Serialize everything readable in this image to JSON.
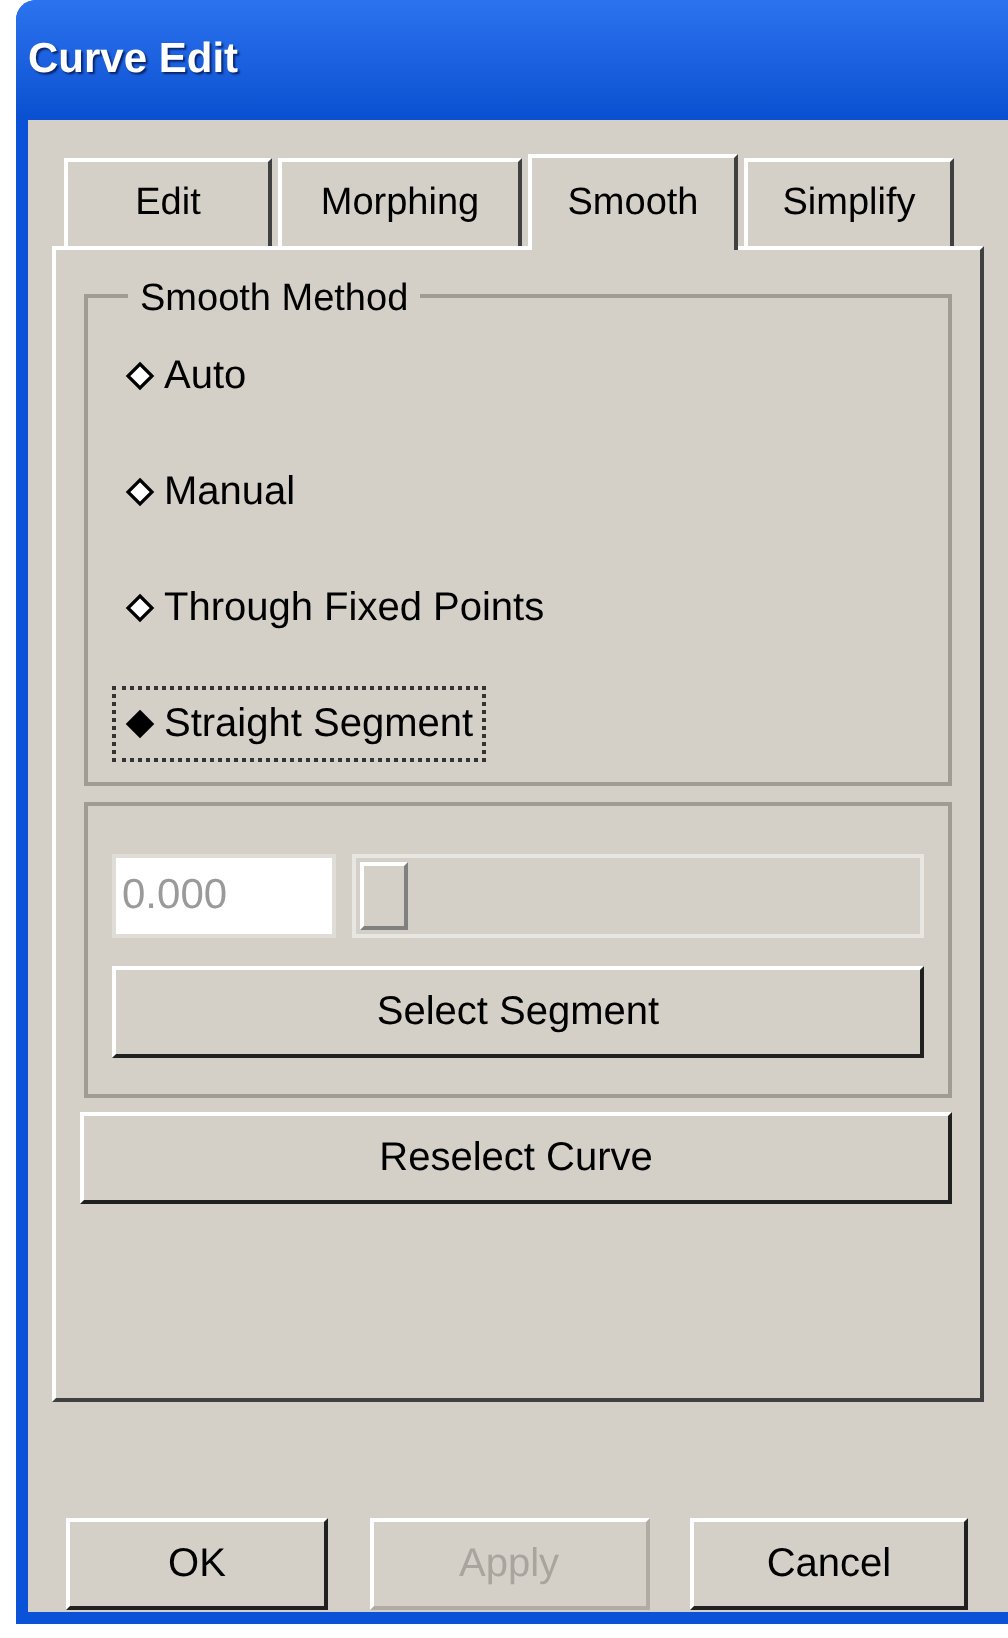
{
  "window": {
    "title": "Curve Edit"
  },
  "tabs": [
    {
      "label": "Edit",
      "selected": false
    },
    {
      "label": "Morphing",
      "selected": false
    },
    {
      "label": "Smooth",
      "selected": true
    },
    {
      "label": "Simplify",
      "selected": false
    }
  ],
  "smooth_method": {
    "title": "Smooth Method",
    "options": [
      {
        "label": "Auto",
        "selected": false,
        "focused": false
      },
      {
        "label": "Manual",
        "selected": false,
        "focused": false
      },
      {
        "label": "Through Fixed Points",
        "selected": false,
        "focused": false
      },
      {
        "label": "Straight Segment",
        "selected": true,
        "focused": true
      }
    ]
  },
  "segment": {
    "value": "0.000",
    "disabled": true,
    "slider": {
      "level": 0
    },
    "button": "Select Segment"
  },
  "reselect_button": "Reselect Curve",
  "buttons": [
    {
      "label": "OK",
      "disabled": false
    },
    {
      "label": "Apply",
      "disabled": true
    },
    {
      "label": "Cancel",
      "disabled": false
    }
  ]
}
